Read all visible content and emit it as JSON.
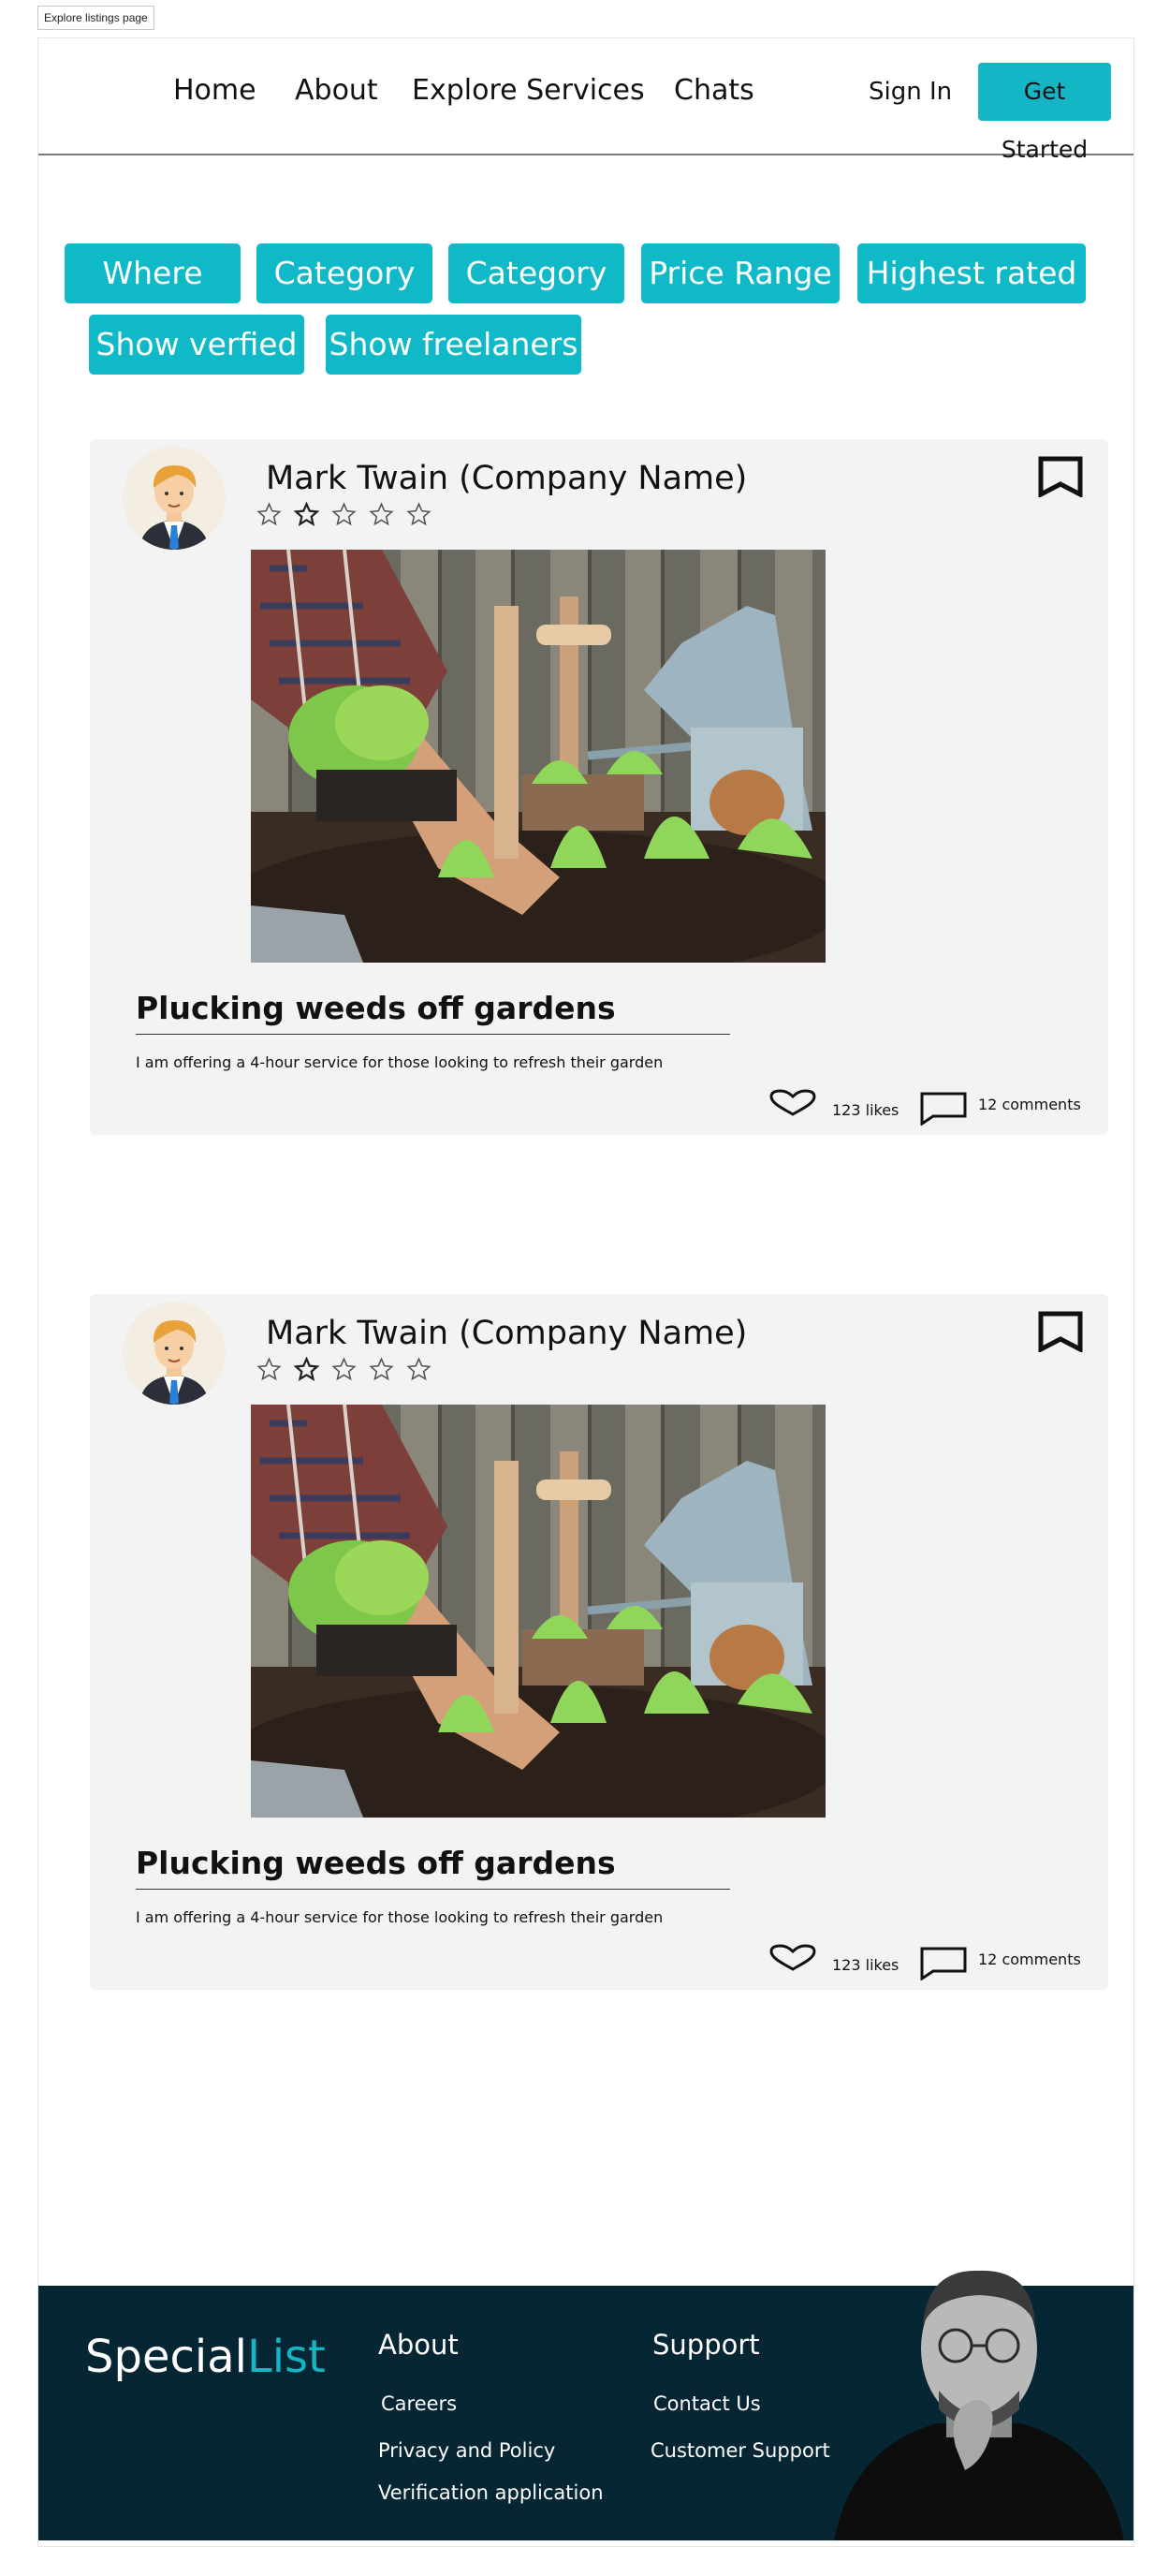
{
  "page_tag": "Explore listings page",
  "nav": {
    "links": [
      "Home",
      "About",
      "Explore Services",
      "Chats"
    ],
    "sign_in": "Sign In",
    "get_started": "Get Started"
  },
  "filters": [
    "Where",
    "Category",
    "Category",
    "Price Range",
    "Highest rated",
    "Show verfied",
    "Show freelaners"
  ],
  "listings": [
    {
      "company": "Mark Twain (Company Name)",
      "rating": 0,
      "title": "Plucking weeds off gardens",
      "description": "I am offering a 4-hour service for those looking to refresh their garden",
      "likes": "123 likes",
      "comments": "12 comments"
    },
    {
      "company": "Mark Twain (Company Name)",
      "rating": 0,
      "title": "Plucking weeds off gardens",
      "description": "I am offering a 4-hour service for those looking to refresh their garden",
      "likes": "123 likes",
      "comments": "12 comments"
    }
  ],
  "footer": {
    "brand_main": "Special",
    "brand_accent": "List",
    "about_heading": "About",
    "about_links": [
      "Careers",
      "Privacy and Policy",
      "Verification application"
    ],
    "support_heading": "Support",
    "support_links": [
      "Contact Us",
      "Customer Support"
    ]
  },
  "colors": {
    "accent": "#14b6c6",
    "footer_bg": "#062633",
    "card_bg": "#f3f3f3"
  },
  "icons": [
    "avatar",
    "star-icon",
    "bookmark-icon",
    "heart-icon",
    "comment-icon"
  ]
}
